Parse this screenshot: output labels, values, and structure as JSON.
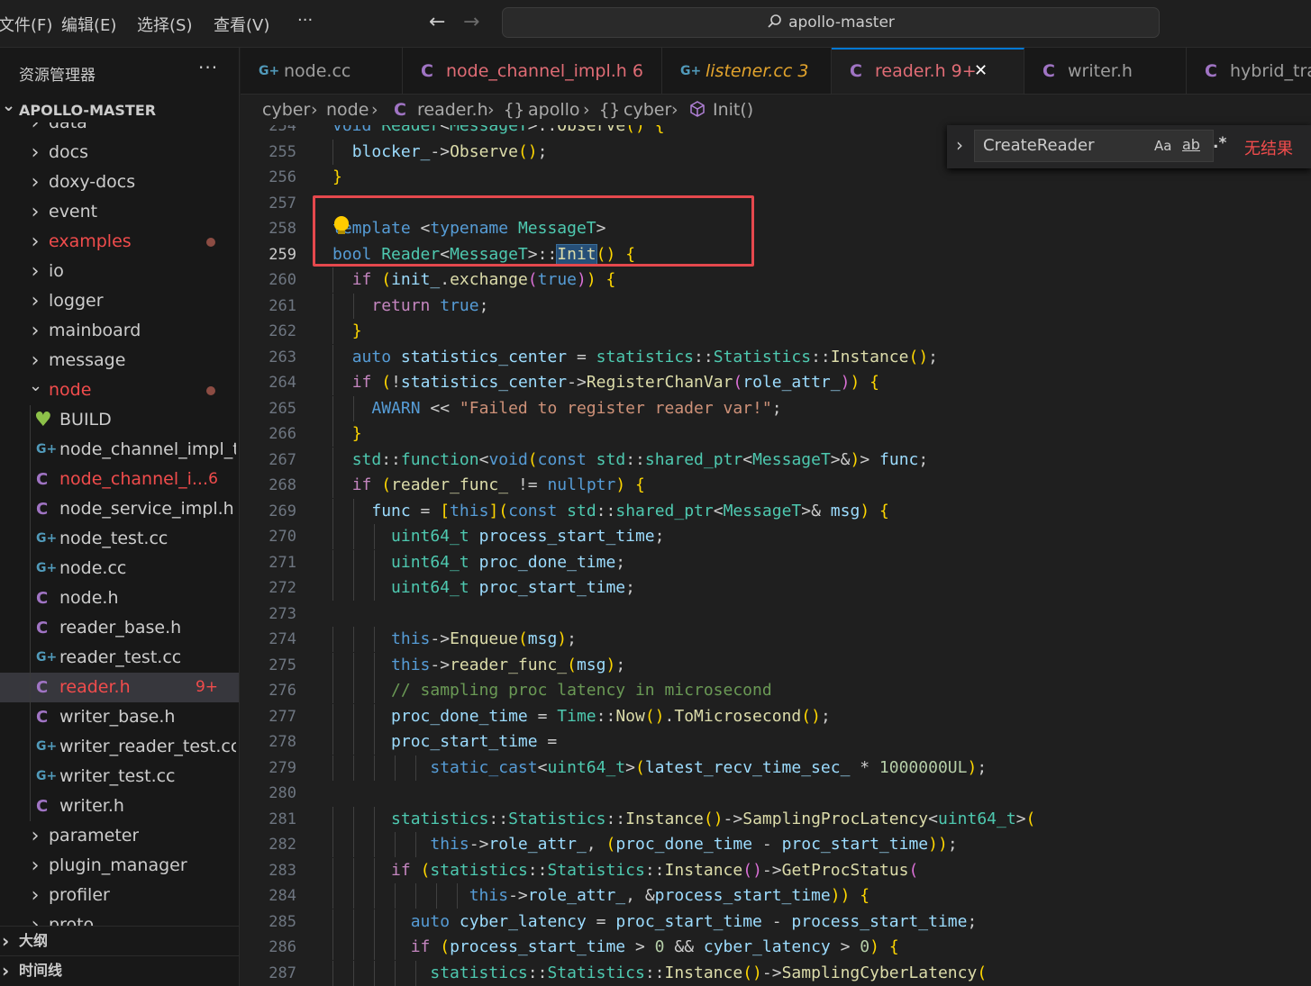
{
  "menu": {
    "file": "文件(F)",
    "edit": "编辑(E)",
    "select": "选择(S)",
    "view": "查看(V)",
    "more": "···"
  },
  "nav": {
    "back": "←",
    "forward": "→"
  },
  "command_center": {
    "text": "apollo-master"
  },
  "sidebar": {
    "title": "资源管理器",
    "more": "···",
    "root": "APOLLO-MASTER",
    "items": [
      {
        "label": "data",
        "type": "folder",
        "color": "#cccccc"
      },
      {
        "label": "docs",
        "type": "folder",
        "color": "#cccccc"
      },
      {
        "label": "doxy-docs",
        "type": "folder",
        "color": "#cccccc"
      },
      {
        "label": "event",
        "type": "folder",
        "color": "#cccccc"
      },
      {
        "label": "examples",
        "type": "folder",
        "color": "#f14c4c",
        "dot": true
      },
      {
        "label": "io",
        "type": "folder",
        "color": "#cccccc"
      },
      {
        "label": "logger",
        "type": "folder",
        "color": "#cccccc"
      },
      {
        "label": "mainboard",
        "type": "folder",
        "color": "#cccccc"
      },
      {
        "label": "message",
        "type": "folder",
        "color": "#cccccc"
      },
      {
        "label": "node",
        "type": "folder-open",
        "color": "#f14c4c",
        "dot": true
      },
      {
        "label": "BUILD",
        "type": "bazel",
        "color": "#cccccc"
      },
      {
        "label": "node_channel_impl_t...",
        "type": "cpp",
        "color": "#cccccc"
      },
      {
        "label": "node_channel_i...",
        "type": "header",
        "color": "#f14c4c",
        "badge": "6"
      },
      {
        "label": "node_service_impl.h",
        "type": "header",
        "color": "#cccccc"
      },
      {
        "label": "node_test.cc",
        "type": "cpp",
        "color": "#cccccc"
      },
      {
        "label": "node.cc",
        "type": "cpp",
        "color": "#cccccc"
      },
      {
        "label": "node.h",
        "type": "header",
        "color": "#cccccc"
      },
      {
        "label": "reader_base.h",
        "type": "header",
        "color": "#cccccc"
      },
      {
        "label": "reader_test.cc",
        "type": "cpp",
        "color": "#cccccc"
      },
      {
        "label": "reader.h",
        "type": "header",
        "color": "#f14c4c",
        "badge": "9+",
        "selected": true
      },
      {
        "label": "writer_base.h",
        "type": "header",
        "color": "#cccccc"
      },
      {
        "label": "writer_reader_test.cc",
        "type": "cpp",
        "color": "#cccccc"
      },
      {
        "label": "writer_test.cc",
        "type": "cpp",
        "color": "#cccccc"
      },
      {
        "label": "writer.h",
        "type": "header",
        "color": "#cccccc"
      },
      {
        "label": "parameter",
        "type": "folder",
        "color": "#cccccc"
      },
      {
        "label": "plugin_manager",
        "type": "folder",
        "color": "#cccccc"
      },
      {
        "label": "profiler",
        "type": "folder",
        "color": "#cccccc"
      },
      {
        "label": "proto",
        "type": "folder",
        "color": "#cccccc"
      }
    ],
    "outline": "大纲",
    "timeline": "时间线"
  },
  "tabs": [
    {
      "label": "node.cc",
      "type": "cpp",
      "color": "#9d9d9d",
      "icon_color": "#519aba"
    },
    {
      "label": "node_channel_impl.h 6",
      "type": "header",
      "color": "#e06c75",
      "icon_color": "#a074c4"
    },
    {
      "label": "listener.cc 3",
      "type": "cpp",
      "color": "#e2a32c",
      "icon_color": "#519aba",
      "italic": true
    },
    {
      "label": "reader.h 9+",
      "type": "header",
      "color": "#e06c75",
      "icon_color": "#a074c4",
      "active": true,
      "close": "✕"
    },
    {
      "label": "writer.h",
      "type": "header",
      "color": "#9d9d9d",
      "icon_color": "#a074c4"
    },
    {
      "label": "hybrid_transm",
      "type": "header",
      "color": "#9d9d9d",
      "icon_color": "#a074c4"
    }
  ],
  "icons": {
    "cpp": "G+",
    "header": "C",
    "bazel": "♥",
    "chev_right": "›",
    "chev_down": "⌄"
  },
  "breadcrumb": [
    "cyber",
    "node",
    "reader.h",
    "apollo",
    "cyber",
    "Init()"
  ],
  "find_widget": {
    "value": "CreateReader",
    "match_case": "Aa",
    "whole_word": "ab",
    "regex": ".*",
    "result": "无结果"
  },
  "code": {
    "current_line": 259,
    "lines": [
      {
        "n": 254,
        "text": "void Reader<MessageT>::Observe() {"
      },
      {
        "n": 255,
        "text": "  blocker_->Observe();"
      },
      {
        "n": 256,
        "text": "}"
      },
      {
        "n": 257,
        "text": ""
      },
      {
        "n": 258,
        "text": "template <typename MessageT>"
      },
      {
        "n": 259,
        "text": "bool Reader<MessageT>::Init() {"
      },
      {
        "n": 260,
        "text": "  if (init_.exchange(true)) {"
      },
      {
        "n": 261,
        "text": "    return true;"
      },
      {
        "n": 262,
        "text": "  }"
      },
      {
        "n": 263,
        "text": "  auto statistics_center = statistics::Statistics::Instance();"
      },
      {
        "n": 264,
        "text": "  if (!statistics_center->RegisterChanVar(role_attr_)) {"
      },
      {
        "n": 265,
        "text": "    AWARN << \"Failed to register reader var!\";"
      },
      {
        "n": 266,
        "text": "  }"
      },
      {
        "n": 267,
        "text": "  std::function<void(const std::shared_ptr<MessageT>&)> func;"
      },
      {
        "n": 268,
        "text": "  if (reader_func_ != nullptr) {"
      },
      {
        "n": 269,
        "text": "    func = [this](const std::shared_ptr<MessageT>& msg) {"
      },
      {
        "n": 270,
        "text": "      uint64_t process_start_time;"
      },
      {
        "n": 271,
        "text": "      uint64_t proc_done_time;"
      },
      {
        "n": 272,
        "text": "      uint64_t proc_start_time;"
      },
      {
        "n": 273,
        "text": ""
      },
      {
        "n": 274,
        "text": "      this->Enqueue(msg);"
      },
      {
        "n": 275,
        "text": "      this->reader_func_(msg);"
      },
      {
        "n": 276,
        "text": "      // sampling proc latency in microsecond"
      },
      {
        "n": 277,
        "text": "      proc_done_time = Time::Now().ToMicrosecond();"
      },
      {
        "n": 278,
        "text": "      proc_start_time ="
      },
      {
        "n": 279,
        "text": "          static_cast<uint64_t>(latest_recv_time_sec_ * 1000000UL);"
      },
      {
        "n": 280,
        "text": ""
      },
      {
        "n": 281,
        "text": "      statistics::Statistics::Instance()->SamplingProcLatency<uint64_t>("
      },
      {
        "n": 282,
        "text": "          this->role_attr_, (proc_done_time - proc_start_time));"
      },
      {
        "n": 283,
        "text": "      if (statistics::Statistics::Instance()->GetProcStatus("
      },
      {
        "n": 284,
        "text": "              this->role_attr_, &process_start_time)) {"
      },
      {
        "n": 285,
        "text": "        auto cyber_latency = proc_start_time - process_start_time;"
      },
      {
        "n": 286,
        "text": "        if (process_start_time > 0 && cyber_latency > 0) {"
      },
      {
        "n": 287,
        "text": "          statistics::Statistics::Instance()->SamplingCyberLatency("
      }
    ]
  }
}
